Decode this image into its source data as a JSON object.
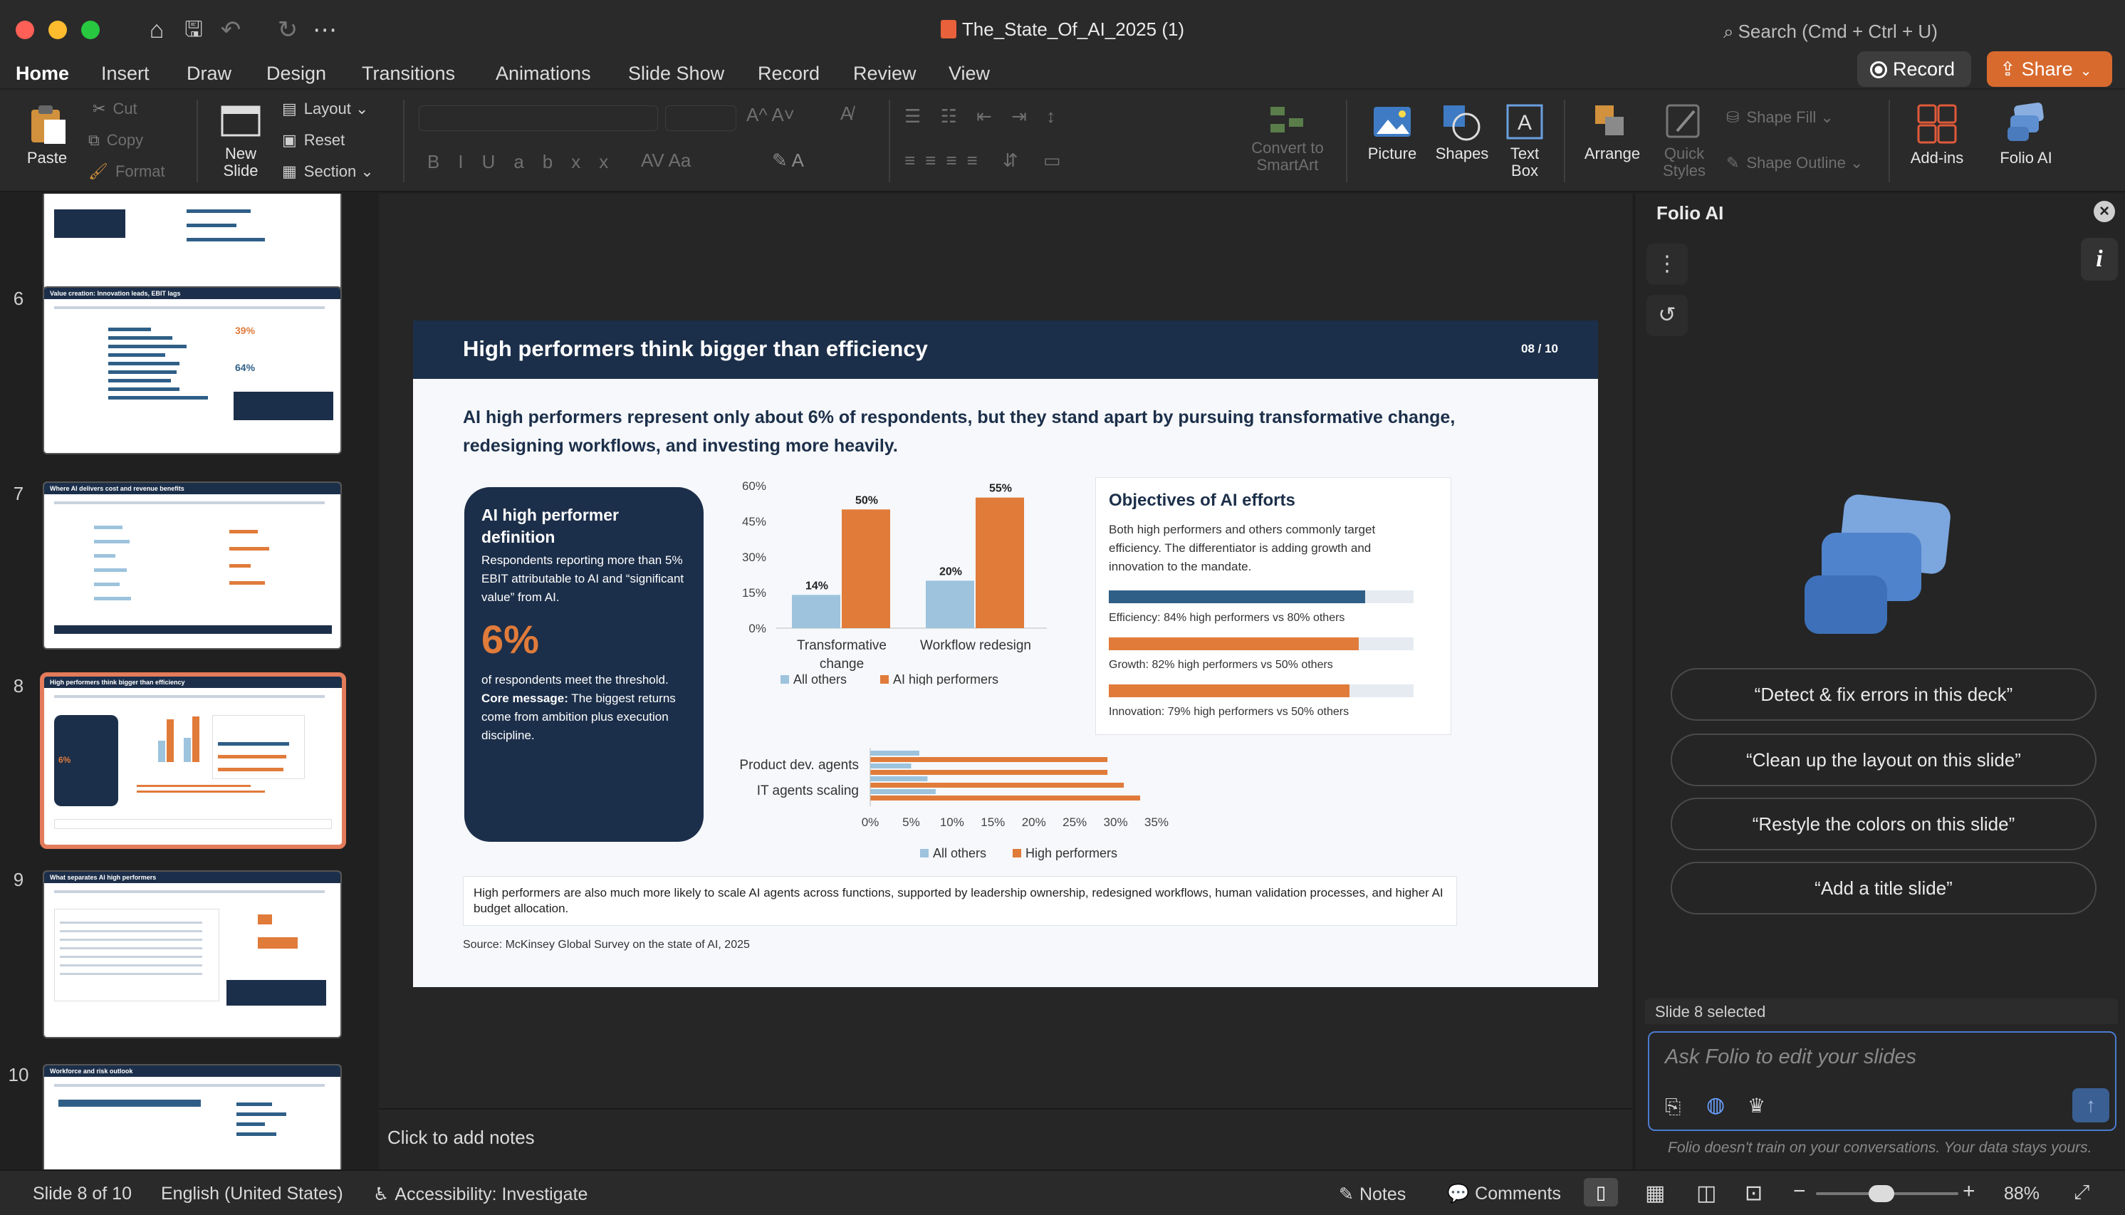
{
  "window": {
    "title": "The_State_Of_AI_2025 (1)",
    "search_placeholder": "Search (Cmd + Ctrl + U)"
  },
  "menu": {
    "tabs": [
      "Home",
      "Insert",
      "Draw",
      "Design",
      "Transitions",
      "Animations",
      "Slide Show",
      "Record",
      "Review",
      "View"
    ],
    "record_label": "Record",
    "share_label": "Share"
  },
  "ribbon": {
    "paste": "Paste",
    "cut": "Cut",
    "copy": "Copy",
    "format": "Format",
    "new_slide_1": "New",
    "new_slide_2": "Slide",
    "layout": "Layout",
    "reset": "Reset",
    "section": "Section",
    "convert_1": "Convert to",
    "convert_2": "SmartArt",
    "picture": "Picture",
    "shapes": "Shapes",
    "textbox_1": "Text",
    "textbox_2": "Box",
    "arrange": "Arrange",
    "quick_1": "Quick",
    "quick_2": "Styles",
    "shape_fill": "Shape Fill",
    "shape_outline": "Shape Outline",
    "addins": "Add-ins",
    "folio": "Folio AI"
  },
  "thumbnails": [
    {
      "num": "6",
      "title": "Value creation: Innovation leads, EBIT lags"
    },
    {
      "num": "7",
      "title": "Where AI delivers cost and revenue benefits"
    },
    {
      "num": "8",
      "title": "High performers think bigger than efficiency"
    },
    {
      "num": "9",
      "title": "What separates AI high performers"
    },
    {
      "num": "10",
      "title": "Workforce and risk outlook"
    }
  ],
  "slide": {
    "title": "High performers think bigger than efficiency",
    "number": "08 / 10",
    "subtitle": "AI high performers represent only about 6% of respondents, but they stand apart by pursuing transformative change, redesigning workflows, and investing more heavily.",
    "definition": {
      "title": "AI high performer definition",
      "text": "Respondents reporting more than 5% EBIT attributable to AI and “significant value” from AI.",
      "big": "6%",
      "after": "of respondents meet the threshold.",
      "core_label": "Core message:",
      "core_text": " The biggest returns come from ambition plus execution discipline."
    },
    "objectives": {
      "title": "Objectives of AI efforts",
      "text": "Both high performers and others commonly target efficiency. The differentiator is adding growth and innovation to the mandate.",
      "rows": [
        {
          "label": "Efficiency: 84% high performers vs 80% others",
          "value": 84,
          "color": "#2f5f87"
        },
        {
          "label": "Growth: 82% high performers vs 50% others",
          "value": 82,
          "color": "#e07b3a"
        },
        {
          "label": "Innovation: 79% high performers vs 50% others",
          "value": 79,
          "color": "#e07b3a"
        }
      ]
    },
    "note": "High performers are also much more likely to scale AI agents across functions, supported by leadership ownership, redesigned workflows, human validation processes, and higher AI budget allocation.",
    "source": "Source: McKinsey Global Survey on the state of AI, 2025"
  },
  "chart_data": [
    {
      "type": "bar",
      "categories": [
        "Transformative change",
        "Workflow redesign"
      ],
      "series": [
        {
          "name": "All others",
          "values": [
            14,
            20
          ],
          "color": "#9dc3dd"
        },
        {
          "name": "AI high performers",
          "values": [
            50,
            55
          ],
          "color": "#e07b3a"
        }
      ],
      "ylim": [
        0,
        60
      ],
      "yticks": [
        "0%",
        "15%",
        "30%",
        "45%",
        "60%"
      ],
      "value_labels": [
        "14%",
        "50%",
        "20%",
        "55%"
      ],
      "legend": "bottom"
    },
    {
      "type": "bar",
      "orientation": "horizontal",
      "categories": [
        "Product dev. agents",
        "IT agents scaling"
      ],
      "series": [
        {
          "name": "All others",
          "values": [
            [
              6,
              5
            ],
            [
              7,
              8
            ]
          ],
          "color": "#9dc3dd"
        },
        {
          "name": "High performers",
          "values": [
            [
              29,
              29
            ],
            [
              31,
              33
            ]
          ],
          "color": "#e07b3a"
        }
      ],
      "xlim": [
        0,
        35
      ],
      "xticks": [
        "0%",
        "5%",
        "10%",
        "15%",
        "20%",
        "25%",
        "30%",
        "35%"
      ],
      "legend": "bottom"
    }
  ],
  "notes_placeholder": "Click to add notes",
  "folio": {
    "title": "Folio AI",
    "prompts": [
      "“Detect & fix errors in this deck”",
      "“Clean up the layout on this slide”",
      "“Restyle the colors on this slide”",
      "“Add a title slide”"
    ],
    "selection": "Slide 8 selected",
    "input_placeholder": "Ask Folio to edit your slides",
    "disclaimer": "Folio doesn't train on your conversations. Your data stays yours."
  },
  "status": {
    "slide": "Slide 8 of 10",
    "language": "English (United States)",
    "accessibility": "Accessibility: Investigate",
    "notes": "Notes",
    "comments": "Comments",
    "zoom": "88%"
  }
}
